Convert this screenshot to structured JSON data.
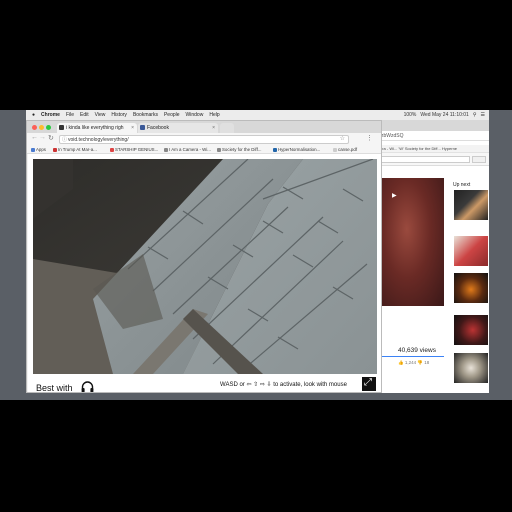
{
  "menubar": {
    "apple": "",
    "app": "Chrome",
    "menus": [
      "File",
      "Edit",
      "View",
      "History",
      "Bookmarks",
      "People",
      "Window",
      "Help"
    ],
    "battery": "100%",
    "clock": "Wed May 24  11:10:01",
    "extra": ""
  },
  "tabs": [
    {
      "label": "i kinda like everything righ",
      "active": true
    },
    {
      "label": "Facebook",
      "active": false
    }
  ],
  "address": {
    "url": "void.technology/everything/"
  },
  "bookmarks": {
    "apps": "Apps",
    "items": [
      "In Trump At Mar-a...",
      "STARSHIP GENIUS...",
      "I Am a Camera - Wi...",
      "Society for the Diff...",
      "HyperNormalisation...",
      "canse.pdf"
    ]
  },
  "bg_window": {
    "url_tail": "zbWzdSQ",
    "bookmarks_tail": "era - Wi...   'W' Society for the Diff...   Hyperne",
    "up_next": "Up next",
    "views": "40,639 views",
    "likes": "1,244",
    "dislikes": "18"
  },
  "caption": {
    "best_with": "Best with",
    "hint": "WASD or ⇦ ⇧ ⇨ ⇩ to activate, look with mouse"
  },
  "colors": {
    "wall_panel": "#8d9698",
    "scene_dark": "#3c3a36",
    "floor": "#6e6a63"
  }
}
